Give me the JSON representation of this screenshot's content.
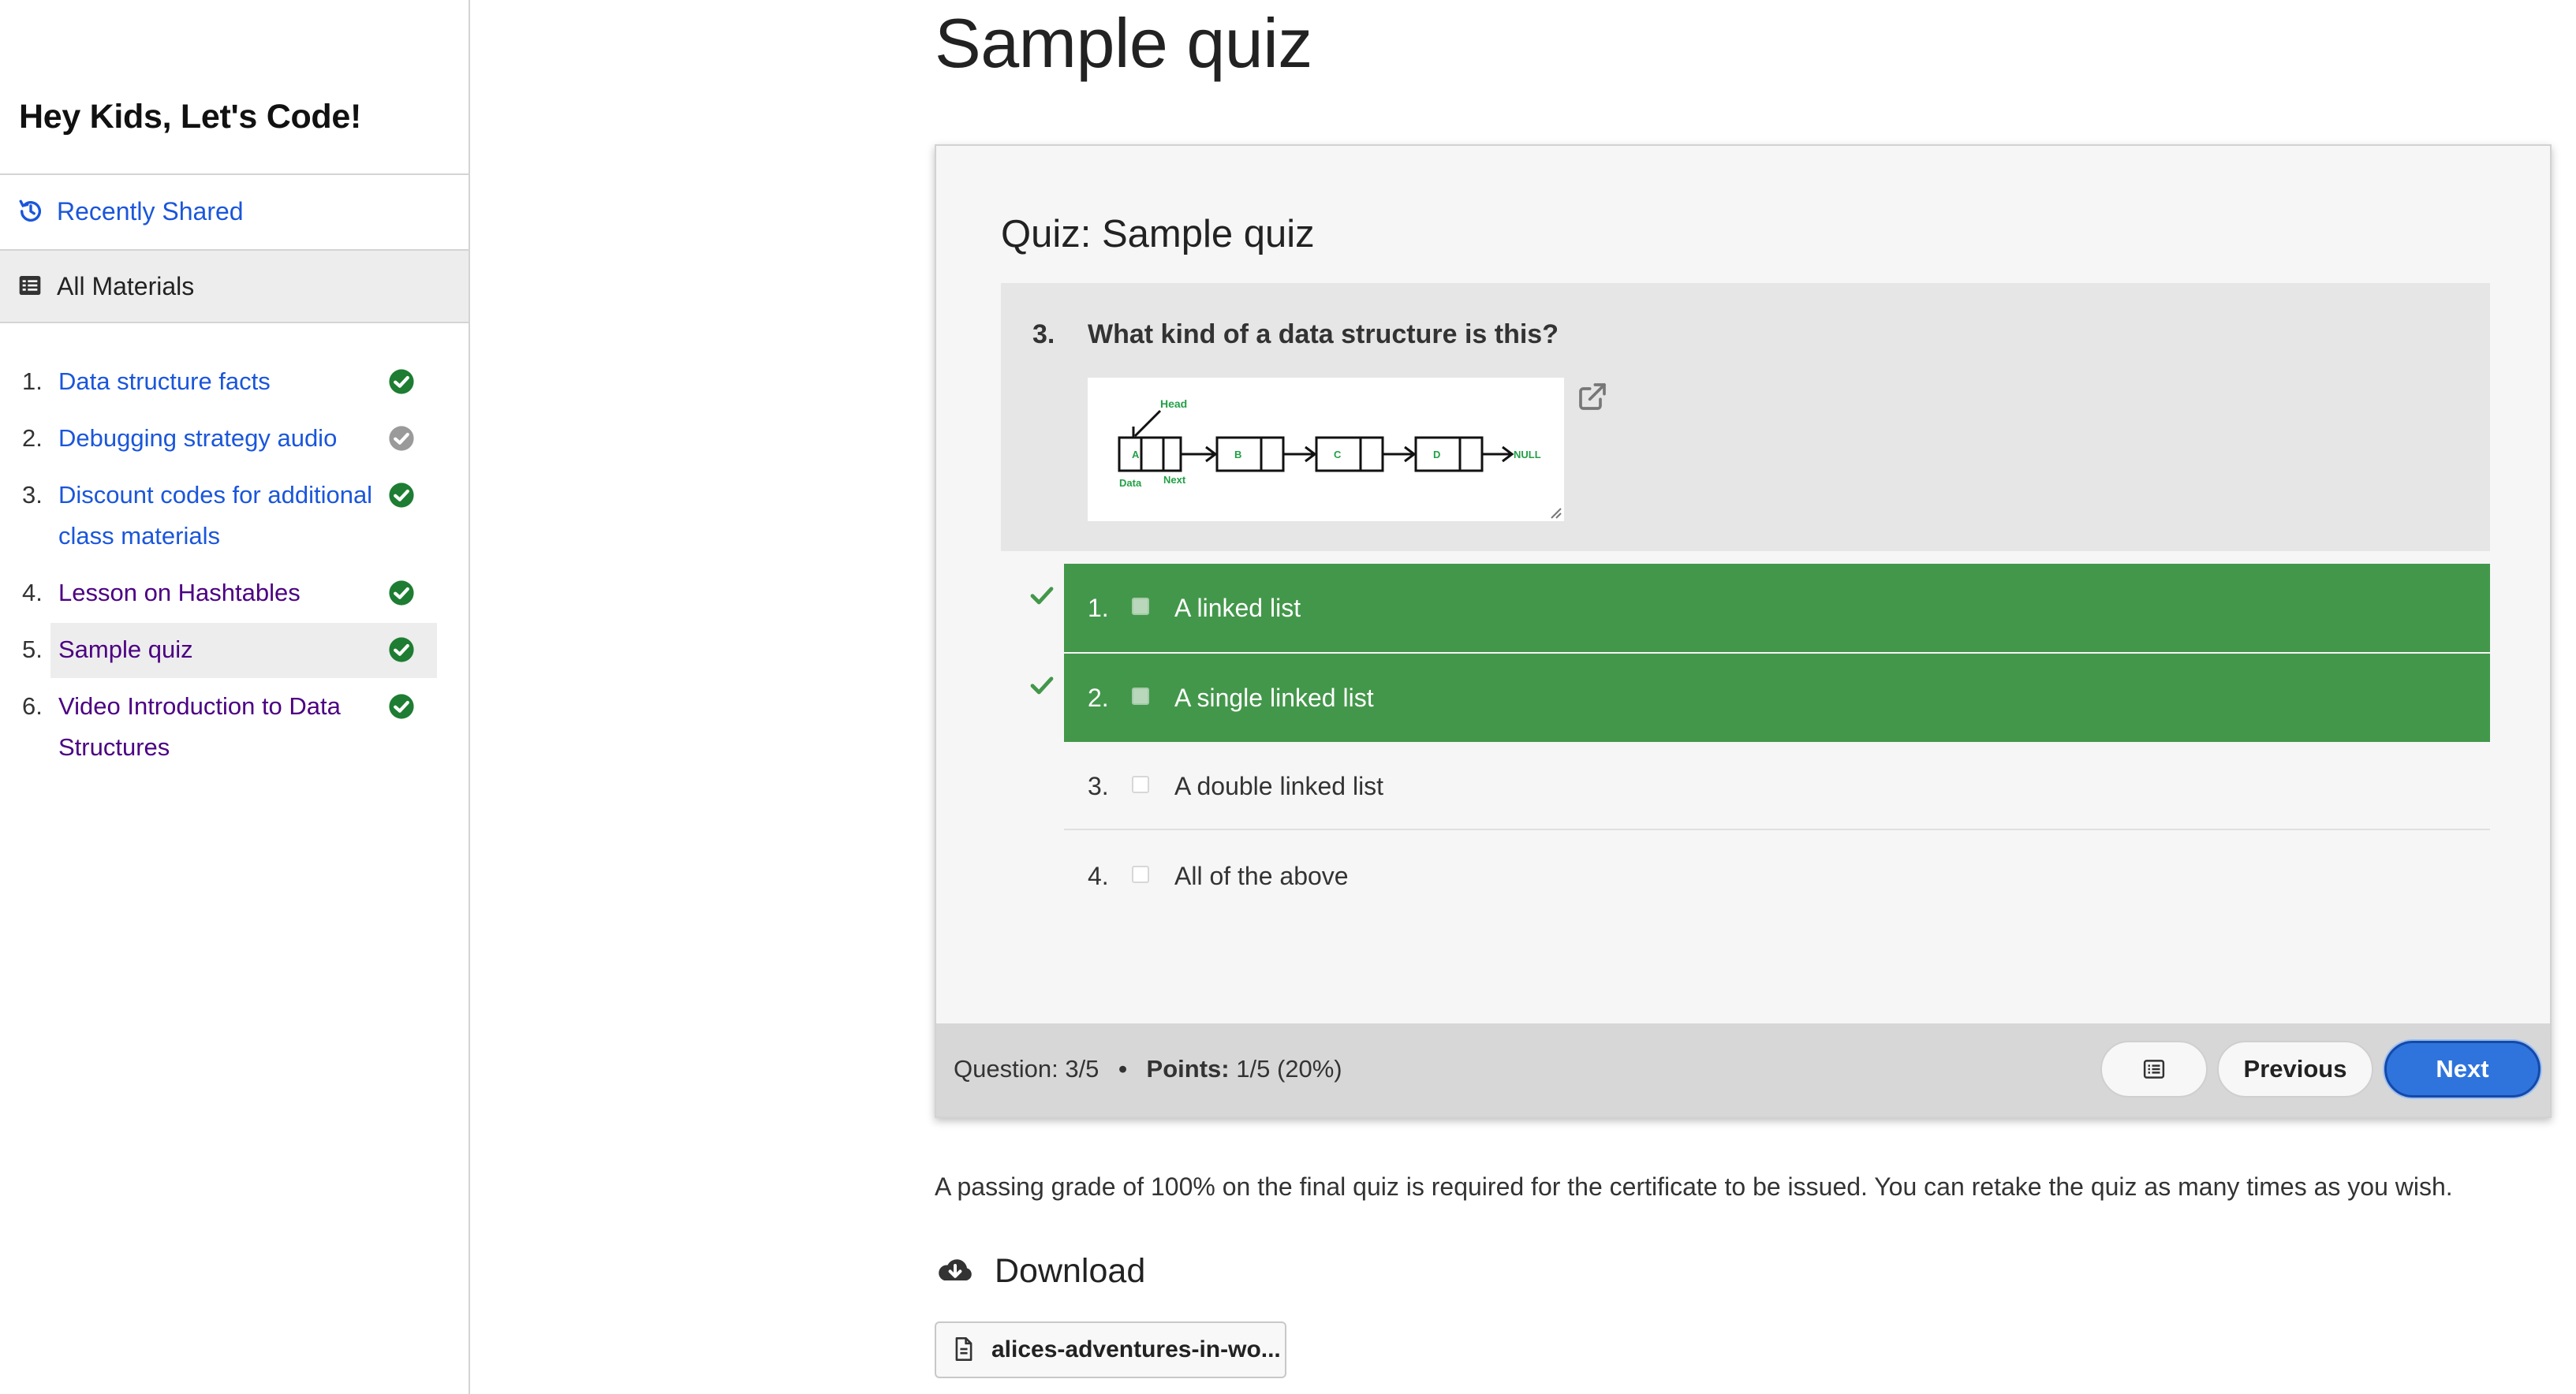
{
  "sidebar": {
    "site_title": "Hey Kids, Let's Code!",
    "recently_shared": "Recently Shared",
    "all_materials": "All Materials",
    "lessons": [
      {
        "num": "1.",
        "title": "Data structure facts",
        "status": "complete"
      },
      {
        "num": "2.",
        "title": "Debugging strategy audio",
        "status": "incomplete"
      },
      {
        "num": "3.",
        "title": "Discount codes for additional class materials",
        "status": "complete"
      },
      {
        "num": "4.",
        "title": "Lesson on Hashtables",
        "status": "complete"
      },
      {
        "num": "5.",
        "title": "Sample quiz",
        "status": "complete",
        "active": true
      },
      {
        "num": "6.",
        "title": "Video Introduction to Data Structures",
        "status": "complete"
      }
    ]
  },
  "main": {
    "page_title": "Sample quiz",
    "quiz": {
      "heading": "Quiz: Sample quiz",
      "question_number": "3.",
      "question_text": "What kind of a data structure is this?",
      "diagram": {
        "head_label": "Head",
        "nodes": [
          "A",
          "B",
          "C",
          "D"
        ],
        "null_label": "NULL",
        "data_label": "Data",
        "next_label": "Next"
      },
      "answers": [
        {
          "num": "1.",
          "label": "A linked list",
          "selected": true,
          "correct": true
        },
        {
          "num": "2.",
          "label": "A single linked list",
          "selected": true,
          "correct": true
        },
        {
          "num": "3.",
          "label": "A double linked list",
          "selected": false,
          "correct": false
        },
        {
          "num": "4.",
          "label": "All of the above",
          "selected": false,
          "correct": false
        }
      ],
      "footer": {
        "question_label": "Question:",
        "question_value": "3/5",
        "points_label": "Points:",
        "points_value": "1/5 (20%)",
        "previous_label": "Previous",
        "next_label": "Next"
      }
    },
    "notice": "A passing grade of 100% on the final quiz is required for the certificate to be issued. You can retake the quiz as many times as you wish.",
    "download": {
      "heading": "Download",
      "file_name": "alices-adventures-in-wo..."
    }
  },
  "colors": {
    "link": "#1a56db",
    "visited": "#4b0082",
    "correct_green": "#43974a",
    "status_green": "#1e7d32",
    "next_button": "#2f74dc"
  }
}
